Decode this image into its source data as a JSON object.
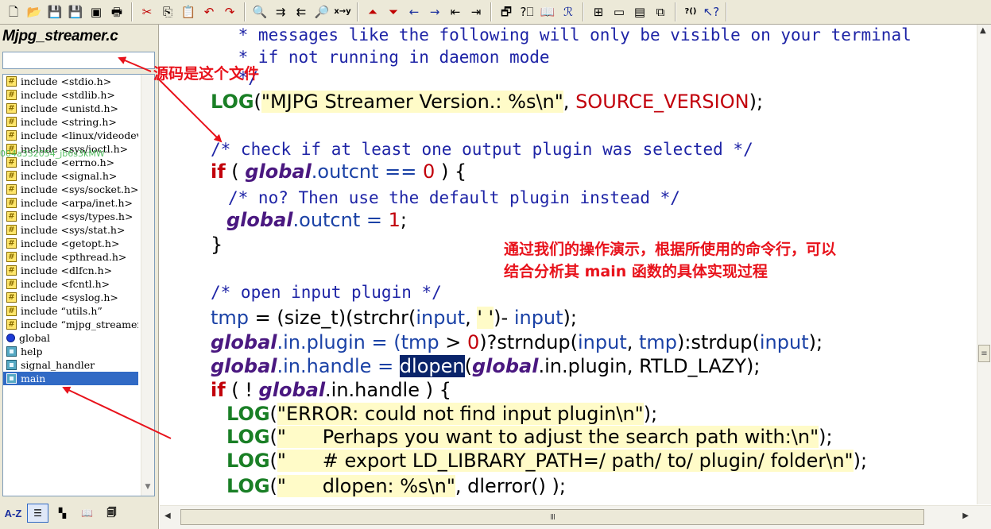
{
  "toolbar": {
    "buttons": [
      {
        "name": "new-file",
        "glyph": "🗋"
      },
      {
        "name": "open-file",
        "glyph": "📂"
      },
      {
        "name": "save-file",
        "glyph": "💾"
      },
      {
        "name": "save-all",
        "glyph": "💾"
      },
      {
        "name": "close-file",
        "glyph": "▣"
      },
      {
        "name": "print",
        "glyph": "🖶"
      },
      {
        "name": "cut",
        "glyph": "✂"
      },
      {
        "name": "copy",
        "glyph": "⎘"
      },
      {
        "name": "paste",
        "glyph": "📋"
      },
      {
        "name": "undo",
        "glyph": "↶"
      },
      {
        "name": "redo",
        "glyph": "↷"
      },
      {
        "name": "find",
        "glyph": "🔍"
      },
      {
        "name": "find-next",
        "glyph": "⇉"
      },
      {
        "name": "find-previous",
        "glyph": "⇇"
      },
      {
        "name": "find-in-files",
        "glyph": "🔎"
      },
      {
        "name": "replace",
        "glyph": "x→y"
      },
      {
        "name": "bookmark-prev",
        "glyph": "⏶"
      },
      {
        "name": "bookmark-next",
        "glyph": "⏷"
      },
      {
        "name": "back",
        "glyph": "←"
      },
      {
        "name": "forward",
        "glyph": "→"
      },
      {
        "name": "outdent",
        "glyph": "⇤"
      },
      {
        "name": "indent",
        "glyph": "⇥"
      },
      {
        "name": "project-window",
        "glyph": "🗗"
      },
      {
        "name": "jump-definition",
        "glyph": "?⎕"
      },
      {
        "name": "symbol-book",
        "glyph": "📖"
      },
      {
        "name": "references",
        "glyph": "ℛ"
      },
      {
        "name": "window-tile",
        "glyph": "⊞"
      },
      {
        "name": "window-horizontal",
        "glyph": "▭"
      },
      {
        "name": "window-vertical",
        "glyph": "▤"
      },
      {
        "name": "window-cascade",
        "glyph": "⧉"
      },
      {
        "name": "help-context",
        "glyph": "?()"
      },
      {
        "name": "help-pointer",
        "glyph": "↖?"
      }
    ]
  },
  "left_panel": {
    "file_title": "Mjpg_streamer.c",
    "filter_value": "",
    "watermark": "004a332054_jb6s3kMW",
    "symbols": [
      {
        "kind": "include",
        "text": "include <stdio.h>"
      },
      {
        "kind": "include",
        "text": "include <stdlib.h>"
      },
      {
        "kind": "include",
        "text": "include <unistd.h>"
      },
      {
        "kind": "include",
        "text": "include <string.h>"
      },
      {
        "kind": "include",
        "text": "include <linux/videodev.h>"
      },
      {
        "kind": "include",
        "text": "include <sys/ioctl.h>"
      },
      {
        "kind": "include",
        "text": "include <errno.h>"
      },
      {
        "kind": "include",
        "text": "include <signal.h>"
      },
      {
        "kind": "include",
        "text": "include <sys/socket.h>"
      },
      {
        "kind": "include",
        "text": "include <arpa/inet.h>"
      },
      {
        "kind": "include",
        "text": "include <sys/types.h>"
      },
      {
        "kind": "include",
        "text": "include <sys/stat.h>"
      },
      {
        "kind": "include",
        "text": "include <getopt.h>"
      },
      {
        "kind": "include",
        "text": "include <pthread.h>"
      },
      {
        "kind": "include",
        "text": "include <dlfcn.h>"
      },
      {
        "kind": "include",
        "text": "include <fcntl.h>"
      },
      {
        "kind": "include",
        "text": "include <syslog.h>"
      },
      {
        "kind": "include",
        "text": "include “utils.h”"
      },
      {
        "kind": "include",
        "text": "include “mjpg_streamer.h”"
      },
      {
        "kind": "global",
        "text": "global"
      },
      {
        "kind": "func",
        "text": "help"
      },
      {
        "kind": "func",
        "text": "signal_handler"
      },
      {
        "kind": "func",
        "text": "main",
        "selected": true
      }
    ],
    "panel_buttons": [
      {
        "name": "sort-az",
        "label": "A-Z"
      },
      {
        "name": "list-view",
        "label": "☰"
      },
      {
        "name": "category-view",
        "label": "▚"
      },
      {
        "name": "symbol-book",
        "label": "📖"
      },
      {
        "name": "symbol-options",
        "label": "🗐"
      }
    ]
  },
  "code": {
    "comment_1": " * messages like the following will only be visible on your terminal",
    "comment_2": " * if not running in daemon mode",
    "comment_3": " */",
    "log_version": {
      "fn": "LOG",
      "p1": "(",
      "str": "\"MJPG Streamer Version.: %s\\n\"",
      "sep": ", ",
      "macro": "SOURCE_VERSION",
      "end": ");"
    },
    "comment_check": "/* check if at least one output plugin was selected */",
    "if_outcnt": {
      "kw": "if",
      "p1": " ( ",
      "gl": "global",
      "field": ".outcnt == ",
      "num": "0",
      "end": " ) {"
    },
    "comment_default": "/* no? Then use the default plugin instead */",
    "assign_outcnt": {
      "gl": "global",
      "field": ".outcnt = ",
      "num": "1",
      "end": ";"
    },
    "close_brace": "}",
    "comment_open": "/* open input plugin */",
    "tmp_line": {
      "id": "tmp",
      "a": " = (size_t)(strchr(",
      "arg": "input",
      "b": ", ",
      "str": "' '",
      "c": ")- ",
      "arg2": "input",
      "d": ");"
    },
    "plugin_line": {
      "gl": "global",
      "a": ".in.plugin = (",
      "id": "tmp",
      "b": " > ",
      "num": "0",
      "c": ")?strndup(",
      "arg": "input",
      "d": ", ",
      "id2": "tmp",
      "e": "):strdup(",
      "arg2": "input",
      "f": ");"
    },
    "handle_line": {
      "gl": "global",
      "a": ".in.handle = ",
      "sel": "dlopen",
      "b": "(",
      "gl2": "global",
      "c": ".in.plugin, RTLD_LAZY);"
    },
    "if_handle": {
      "kw": "if",
      "a": " ( ! ",
      "gl": "global",
      "b": ".in.handle ) {"
    },
    "log_error_1": {
      "fn": "LOG",
      "p": "(",
      "str": "\"ERROR: could not find input plugin\\n\"",
      "end": ");"
    },
    "log_error_2": {
      "fn": "LOG",
      "p": "(",
      "str": "\"      Perhaps you want to adjust the search path with:\\n\"",
      "end": ");"
    },
    "log_error_3": {
      "fn": "LOG",
      "p": "(",
      "str": "\"      # export LD_LIBRARY_PATH=/ path/ to/ plugin/ folder\\n\"",
      "end": ");"
    },
    "log_error_4": {
      "fn": "LOG",
      "p": "(",
      "str": "\"      dlopen: %s\\n\"",
      "end": ", dlerror() );"
    }
  },
  "annotations": {
    "source_file": "源码是这个文件",
    "explain_line_1": "通过我们的操作演示，根据所使用的命令行，可以",
    "explain_line_2": "结合分析其 main 函数的具体实现过程"
  },
  "scrollbars": {
    "grip": "III",
    "thumb_mark": "≡"
  },
  "colors": {
    "keyword": "#c2000b",
    "function": "#1a7f26",
    "global": "#4a1880",
    "comment": "#1e24a6",
    "annotation": "#e8121b",
    "selection": "#0a246a"
  }
}
